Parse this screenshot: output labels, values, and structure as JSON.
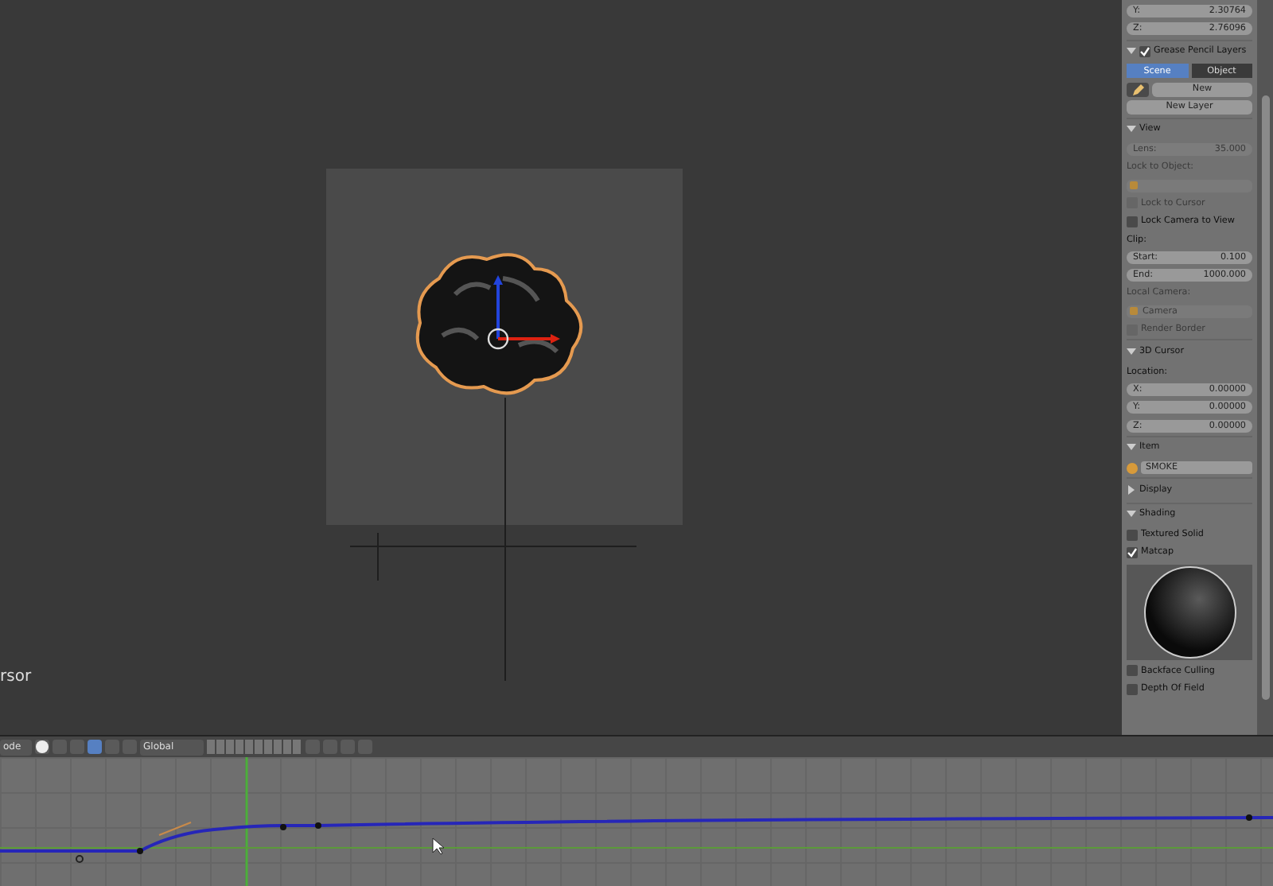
{
  "viewport": {
    "overlay_text": "rsor",
    "selected_object": {
      "selected": true
    }
  },
  "properties_panel": {
    "rows": [
      {
        "kind": "field",
        "label": "Y:",
        "value": "2.30764",
        "disabled": false
      },
      {
        "kind": "field",
        "label": "Z:",
        "value": "2.76096",
        "disabled": false
      },
      {
        "kind": "header",
        "label": "Grease Pencil Layers",
        "expanded": true,
        "checked": true
      },
      {
        "kind": "tabs",
        "tabs": [
          {
            "label": "Scene",
            "selected": true
          },
          {
            "label": "Object",
            "selected": false
          }
        ]
      },
      {
        "kind": "button",
        "label": "New",
        "with_pencil": true
      },
      {
        "kind": "button",
        "label": "New Layer",
        "with_pencil": false
      },
      {
        "kind": "header",
        "label": "View",
        "expanded": true
      },
      {
        "kind": "field",
        "label": "Lens:",
        "value": "35.000",
        "disabled": true
      },
      {
        "kind": "label",
        "label": "Lock to Object:",
        "disabled": true
      },
      {
        "kind": "dropdown",
        "label": "",
        "disabled": true
      },
      {
        "kind": "checkbox",
        "label": "Lock to Cursor",
        "checked": false,
        "disabled": true
      },
      {
        "kind": "checkbox",
        "label": "Lock Camera to View",
        "checked": false,
        "disabled": false
      },
      {
        "kind": "label",
        "label": "Clip:",
        "disabled": false
      },
      {
        "kind": "field",
        "label": "Start:",
        "value": "0.100",
        "disabled": false
      },
      {
        "kind": "field",
        "label": "End:",
        "value": "1000.000",
        "disabled": false
      },
      {
        "kind": "label",
        "label": "Local Camera:",
        "disabled": true
      },
      {
        "kind": "dropdown",
        "label": "Camera",
        "disabled": true
      },
      {
        "kind": "checkbox",
        "label": "Render Border",
        "checked": false,
        "disabled": true
      },
      {
        "kind": "header",
        "label": "3D Cursor",
        "expanded": true
      },
      {
        "kind": "label",
        "label": "Location:",
        "disabled": false
      },
      {
        "kind": "field",
        "label": "X:",
        "value": "0.00000",
        "disabled": false
      },
      {
        "kind": "field",
        "label": "Y:",
        "value": "0.00000",
        "disabled": false
      },
      {
        "kind": "field",
        "label": "Z:",
        "value": "0.00000",
        "disabled": false
      },
      {
        "kind": "header",
        "label": "Item",
        "expanded": true
      },
      {
        "kind": "name",
        "label": "SMOKE"
      },
      {
        "kind": "header",
        "label": "Display",
        "expanded": false
      },
      {
        "kind": "header",
        "label": "Shading",
        "expanded": true
      },
      {
        "kind": "checkbox",
        "label": "Textured Solid",
        "checked": false,
        "disabled": false
      },
      {
        "kind": "checkbox",
        "label": "Matcap",
        "checked": true,
        "disabled": false
      },
      {
        "kind": "preview"
      },
      {
        "kind": "checkbox",
        "label": "Backface Culling",
        "checked": false,
        "disabled": false
      },
      {
        "kind": "checkbox",
        "label": "Depth Of Field",
        "checked": false,
        "disabled": false
      }
    ]
  },
  "header_bar": {
    "mode_dropdown": "ode",
    "orientation_dropdown": "Global"
  }
}
